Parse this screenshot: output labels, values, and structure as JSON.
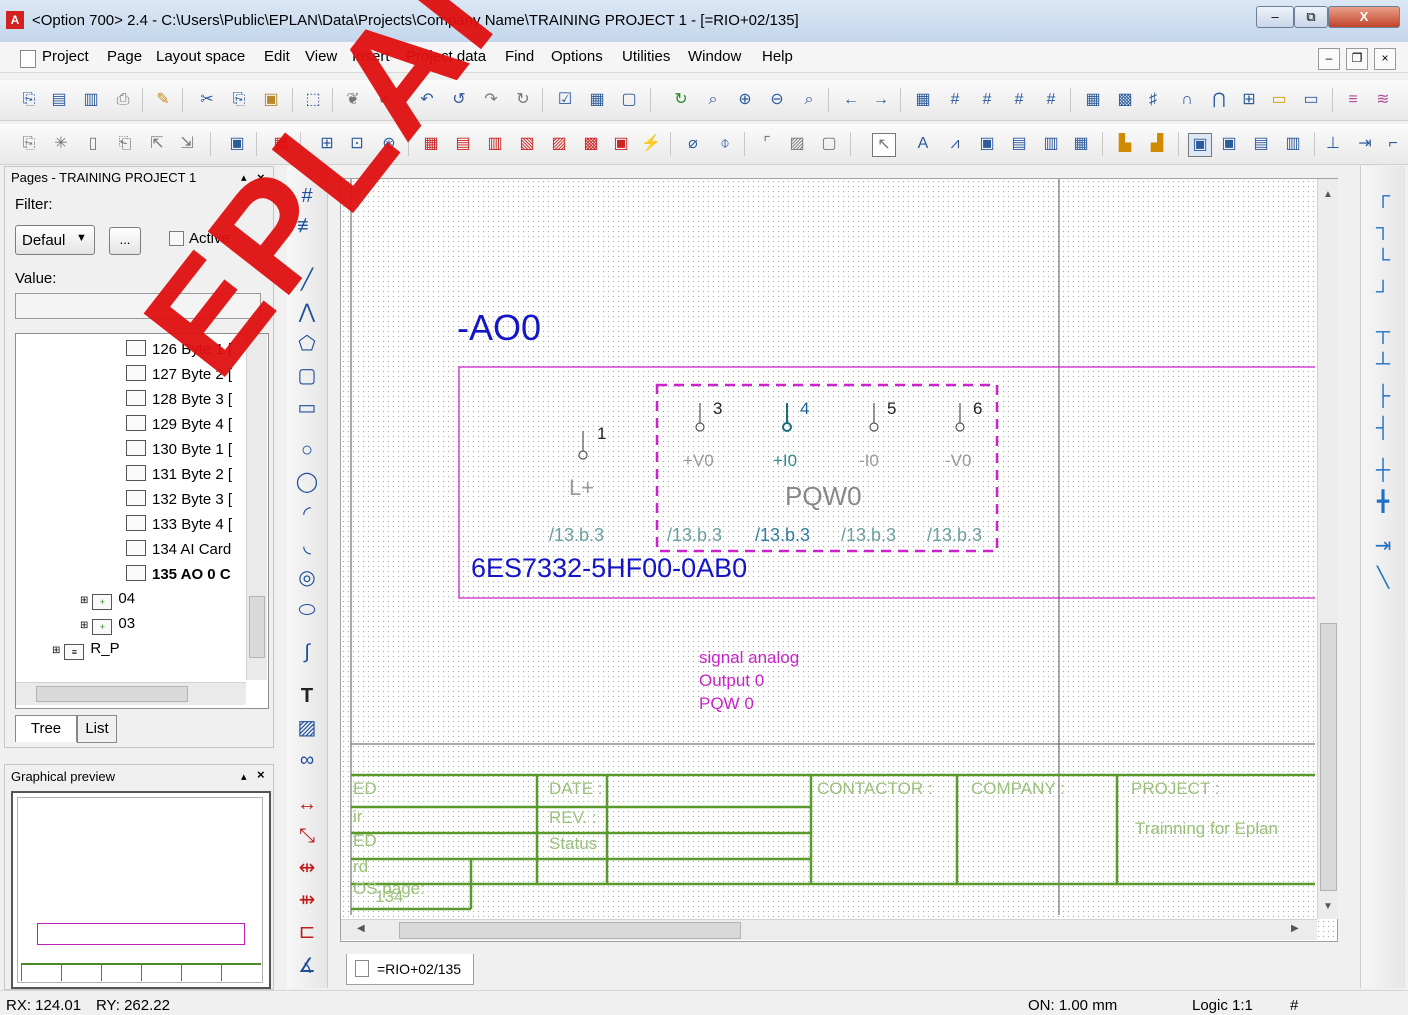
{
  "window": {
    "title": "<Option 700> 2.4 - C:\\Users\\Public\\EPLAN\\Data\\Projects\\Company Name\\TRAINING PROJECT 1 - [=RIO+02/135]",
    "minimize": "–",
    "maximize": "⧉",
    "close": "X"
  },
  "menu": [
    "Project",
    "Page",
    "Layout space",
    "Edit",
    "View",
    "Insert",
    "Project data",
    "Find",
    "Options",
    "Utilities",
    "Window",
    "Help"
  ],
  "pages_panel": {
    "title": "Pages - TRAINING PROJECT 1",
    "filter_label": "Filter:",
    "filter_value": "Defaul",
    "more_button": "...",
    "active_label": "Active",
    "value_label": "Value:",
    "value_text": "",
    "tree_items": [
      {
        "label": "126 Byte 1 [",
        "bold": false
      },
      {
        "label": "127 Byte 2 [",
        "bold": false
      },
      {
        "label": "128 Byte 3 [",
        "bold": false
      },
      {
        "label": "129 Byte 4 [",
        "bold": false
      },
      {
        "label": "130 Byte 1 [",
        "bold": false
      },
      {
        "label": "131 Byte 2 [",
        "bold": false
      },
      {
        "label": "132 Byte 3 [",
        "bold": false
      },
      {
        "label": "133 Byte 4 [",
        "bold": false
      },
      {
        "label": "134 AI Card",
        "bold": false
      },
      {
        "label": "135 AO 0 C",
        "bold": true
      }
    ],
    "tree_groups": [
      "04",
      "03",
      "R_P"
    ],
    "tabs": [
      "Tree",
      "List"
    ],
    "close": "×",
    "pin": "▴"
  },
  "preview_panel": {
    "title": "Graphical preview"
  },
  "schematic": {
    "device_tag": "-AO0",
    "pins": [
      "1",
      "3",
      "4",
      "5",
      "6"
    ],
    "pin_labels": [
      "L+",
      "+V0",
      "+I0",
      "-I0",
      "-V0"
    ],
    "block_label": "PQW0",
    "cross_refs": [
      "/13.b.3",
      "/13.b.3",
      "/13.b.3",
      "/13.b.3",
      "/13.b.3"
    ],
    "part_number": "6ES7332-5HF00-0AB0",
    "function_text": [
      "signal analog",
      "Output 0",
      "PQW 0"
    ],
    "title_block": {
      "left_labels": [
        "ED",
        "ir",
        "ED",
        "rd",
        "OS page:"
      ],
      "page_no": "134",
      "date_label": "DATE :",
      "rev_label": "REV. :",
      "status_label": "Status",
      "contactor_label": "CONTACTOR :",
      "company_label": "COMPANY :",
      "project_label": "PROJECT :",
      "project_value": "Trainning for Eplan"
    }
  },
  "page_tab": "=RIO+02/135",
  "status": {
    "rx": "RX: 124.01",
    "ry": "RY: 262.22",
    "grid": "ON: 1.00 mm",
    "logic": "Logic 1:1",
    "hash": "#"
  },
  "watermark": "EPLAN",
  "colors": {
    "purple": "#cc22cc",
    "blue": "#1414c8",
    "green": "#5a9a2a",
    "teal": "#2d8c8c",
    "red_watermark": "#e01010"
  }
}
